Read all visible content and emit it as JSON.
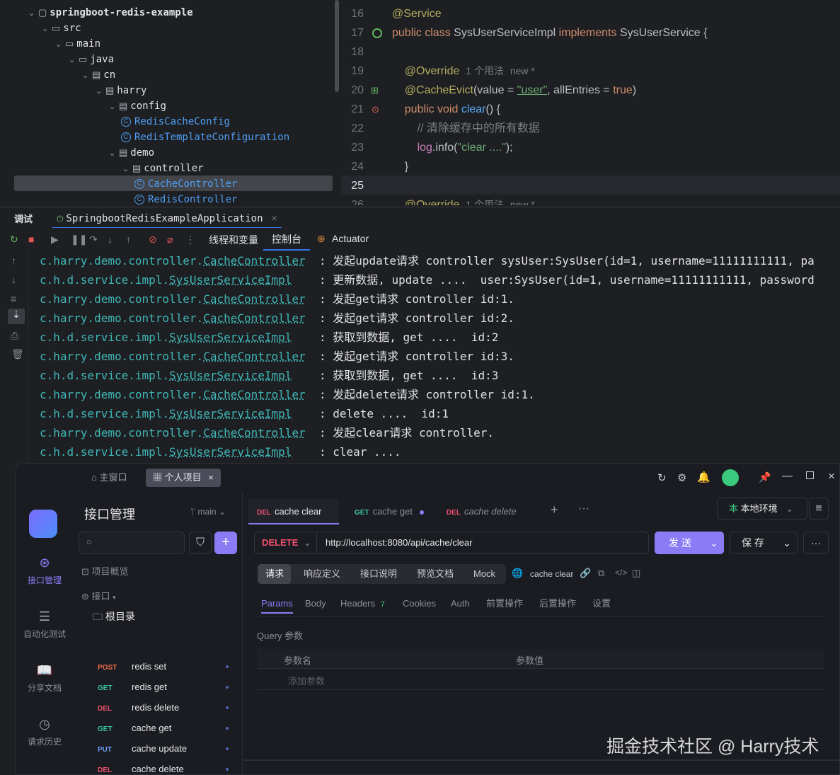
{
  "project_tree": {
    "items": [
      {
        "label": "springboot-redis-example",
        "depth": 0,
        "kind": "module"
      },
      {
        "label": "src",
        "depth": 1,
        "kind": "folder"
      },
      {
        "label": "main",
        "depth": 2,
        "kind": "folder"
      },
      {
        "label": "java",
        "depth": 3,
        "kind": "folder"
      },
      {
        "label": "cn",
        "depth": 4,
        "kind": "package"
      },
      {
        "label": "harry",
        "depth": 5,
        "kind": "package"
      },
      {
        "label": "config",
        "depth": 6,
        "kind": "package"
      },
      {
        "label": "RedisCacheConfig",
        "depth": 7,
        "kind": "class"
      },
      {
        "label": "RedisTemplateConfiguration",
        "depth": 7,
        "kind": "class"
      },
      {
        "label": "demo",
        "depth": 6,
        "kind": "package"
      },
      {
        "label": "controller",
        "depth": 7,
        "kind": "package"
      },
      {
        "label": "CacheController",
        "depth": 8,
        "kind": "class",
        "selected": true
      },
      {
        "label": "RedisController",
        "depth": 8,
        "kind": "class"
      }
    ]
  },
  "editor": {
    "line_numbers": [
      "16",
      "17",
      "18",
      "19",
      "20",
      "21",
      "22",
      "23",
      "24",
      "25",
      "26"
    ],
    "hints": {
      "usage": "1 个用法",
      "new": "new *"
    },
    "lines": {
      "l16": "@Service",
      "l17_kw": "public class ",
      "l17_name": "SysUserServiceImpl ",
      "l17_impl": "implements ",
      "l17_iface": "SysUserService {",
      "l19": "@Override",
      "l20_ann": "@CacheEvict",
      "l20_a": "(value = ",
      "l20_str": "\"user\"",
      "l20_b": ", allEntries = ",
      "l20_true": "true",
      "l20_c": ")",
      "l21_kw": "public void ",
      "l21_fn": "clear",
      "l21_rest": "() {",
      "l22": "// 清除缓存中的所有数据",
      "l23_log": "log",
      "l23_info": ".info(",
      "l23_str": "\"clear ....\"",
      "l23_end": ");",
      "l24": "}",
      "l26": "@Override"
    }
  },
  "debug": {
    "title": "调试",
    "run_config": "SpringbootRedisExampleApplication",
    "tabs": [
      "线程和变量",
      "控制台",
      "Actuator"
    ]
  },
  "console": {
    "lines": [
      {
        "pkg": "c.harry.demo.controller.",
        "cls": "CacheController",
        "msg": "  : 发起update请求 controller sysUser:SysUser(id=1, username=11111111111, pa"
      },
      {
        "pkg": "c.h.d.service.impl.",
        "cls": "SysUserServiceImpl",
        "msg": "    : 更新数据, update ....  user:SysUser(id=1, username=11111111111, password"
      },
      {
        "pkg": "c.harry.demo.controller.",
        "cls": "CacheController",
        "msg": "  : 发起get请求 controller id:1."
      },
      {
        "pkg": "c.harry.demo.controller.",
        "cls": "CacheController",
        "msg": "  : 发起get请求 controller id:2."
      },
      {
        "pkg": "c.h.d.service.impl.",
        "cls": "SysUserServiceImpl",
        "msg": "    : 获取到数据, get ....  id:2"
      },
      {
        "pkg": "c.harry.demo.controller.",
        "cls": "CacheController",
        "msg": "  : 发起get请求 controller id:3."
      },
      {
        "pkg": "c.h.d.service.impl.",
        "cls": "SysUserServiceImpl",
        "msg": "    : 获取到数据, get ....  id:3"
      },
      {
        "pkg": "c.harry.demo.controller.",
        "cls": "CacheController",
        "msg": "  : 发起delete请求 controller id:1."
      },
      {
        "pkg": "c.h.d.service.impl.",
        "cls": "SysUserServiceImpl",
        "msg": "    : delete ....  id:1"
      },
      {
        "pkg": "c.harry.demo.controller.",
        "cls": "CacheController",
        "msg": "  : 发起clear请求 controller."
      },
      {
        "pkg": "c.h.d.service.impl.",
        "cls": "SysUserServiceImpl",
        "msg": "    : clear ...."
      }
    ]
  },
  "apifox": {
    "window_tabs": {
      "home": "主窗口",
      "project": "个人项目"
    },
    "rail": [
      {
        "label": "接口管理",
        "icon": "api-icon",
        "active": true
      },
      {
        "label": "自动化测试",
        "icon": "automation-icon"
      },
      {
        "label": "分享文档",
        "icon": "book-icon"
      },
      {
        "label": "请求历史",
        "icon": "clock-icon"
      }
    ],
    "sidebar": {
      "title": "接口管理",
      "branch": "main",
      "overview": "项目概览",
      "interfaces": "接口",
      "root": "根目录",
      "apis": [
        {
          "method": "POST",
          "name": "redis set"
        },
        {
          "method": "GET",
          "name": "redis get"
        },
        {
          "method": "DEL",
          "name": "redis delete"
        },
        {
          "method": "GET",
          "name": "cache get"
        },
        {
          "method": "PUT",
          "name": "cache update"
        },
        {
          "method": "DEL",
          "name": "cache delete"
        },
        {
          "method": "DEL",
          "name": "cache clear",
          "selected": true
        }
      ]
    },
    "request_tabs": [
      {
        "method": "DEL",
        "name": "cache clear",
        "active": true
      },
      {
        "method": "GET",
        "name": "cache get"
      },
      {
        "method": "DEL",
        "name": "cache delete"
      }
    ],
    "env": "本地环境",
    "method": "DELETE",
    "url": "http://localhost:8080/api/cache/clear",
    "send": "发 送",
    "save": "保 存",
    "sub_tabs": [
      "请求",
      "响应定义",
      "接口说明",
      "预览文档",
      "Mock"
    ],
    "api_name": "cache clear",
    "param_tabs": {
      "params": "Params",
      "body": "Body",
      "headers": "Headers",
      "headers_count": "7",
      "cookies": "Cookies",
      "auth": "Auth",
      "pre": "前置操作",
      "post": "后置操作",
      "settings": "设置"
    },
    "query_label": "Query 参数",
    "col_name": "参数名",
    "col_value": "参数值",
    "add_param": "添加参数",
    "watermark": "掘金技术社区 @ Harry技术"
  }
}
